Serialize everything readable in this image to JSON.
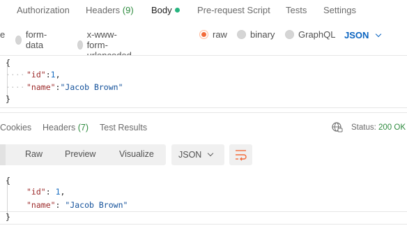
{
  "request_tabs": [
    {
      "label": "Authorization"
    },
    {
      "label": "Headers",
      "count": "(9)"
    },
    {
      "label": "Body"
    },
    {
      "label": "Pre-request Script"
    },
    {
      "label": "Tests"
    },
    {
      "label": "Settings"
    }
  ],
  "body_types": [
    {
      "label": "e"
    },
    {
      "label": "form-data"
    },
    {
      "label": "x-www-form-urlencoded"
    },
    {
      "label": "raw"
    },
    {
      "label": "binary"
    },
    {
      "label": "GraphQL"
    }
  ],
  "body_format": "JSON",
  "request_body": {
    "open": "{",
    "id_key": "\"id\"",
    "id_sep": ":",
    "id_val": "1",
    "comma": ",",
    "name_key": "\"name\"",
    "name_sep": ":",
    "name_val": "\"Jacob Brown\"",
    "close": "}"
  },
  "response_tabs": [
    {
      "label": "Cookies"
    },
    {
      "label": "Headers",
      "count": "(7)"
    },
    {
      "label": "Test Results"
    }
  ],
  "status": {
    "label": "Status:",
    "value": "200 OK"
  },
  "view_modes": [
    {
      "label": "Raw"
    },
    {
      "label": "Preview"
    },
    {
      "label": "Visualize"
    }
  ],
  "response_format": "JSON",
  "response_body": {
    "open": "{",
    "id_key": "\"id\"",
    "id_sep": ": ",
    "id_val": "1",
    "comma": ",",
    "name_key": "\"name\"",
    "name_sep": ": ",
    "name_val": "\"Jacob Brown\"",
    "close": "}"
  }
}
